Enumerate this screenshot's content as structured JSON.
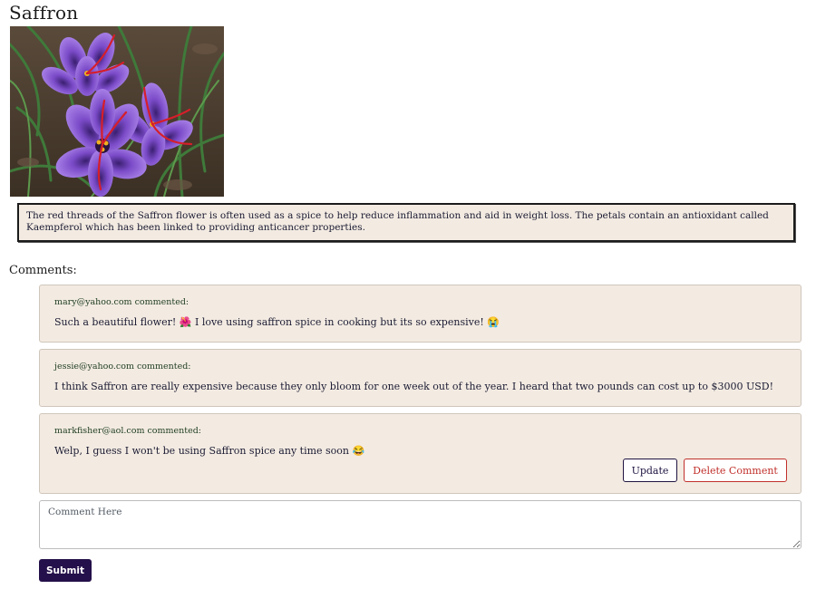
{
  "page": {
    "title": "Saffron",
    "image_alt": "Saffron crocus flowers"
  },
  "description": "The red threads of the Saffron flower is often used as a spice to help reduce inflammation and aid in weight loss. The petals contain an antioxidant called Kaempferol which has been linked to providing anticancer properties.",
  "comments": {
    "heading": "Comments:",
    "items": [
      {
        "author": "mary@yahoo.com commented:",
        "text": "Such a beautiful flower! 🌺  I love using saffron spice in cooking but its so expensive! 😭"
      },
      {
        "author": "jessie@yahoo.com commented:",
        "text": "I think Saffron are really expensive because they only bloom for one week out of the year. I heard that two pounds can cost up to $3000 USD!"
      },
      {
        "author": "markfisher@aol.com commented:",
        "text": "Welp, I guess I won't be using Saffron spice any time soon 😂",
        "actions": {
          "update_label": "Update",
          "delete_label": "Delete Comment"
        }
      }
    ]
  },
  "form": {
    "placeholder": "Comment Here",
    "submit_label": "Submit"
  },
  "colors": {
    "card_background": "#f3ebe2",
    "submit_background": "#24104a",
    "delete_accent": "#c0302b",
    "author_text": "#1f3d1f"
  }
}
